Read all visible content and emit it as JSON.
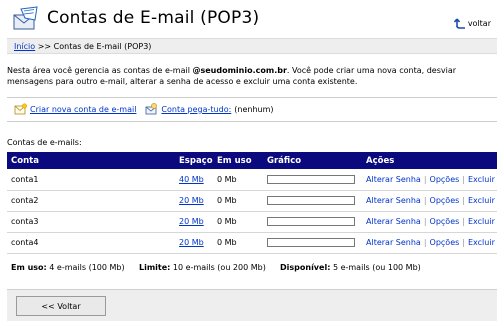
{
  "header": {
    "title": "Contas de E-mail (POP3)",
    "back_label": "voltar"
  },
  "breadcrumb": {
    "home": "Início",
    "separator": ">>",
    "current": "Contas de E-mail (POP3)"
  },
  "intro": {
    "text_before": "Nesta área você gerencia as contas de e-mail ",
    "domain": "@seudominio.com.br",
    "text_after": ". Você pode criar uma nova conta, desviar mensagens para outro e-mail, alterar a senha de acesso e excluir uma conta existente."
  },
  "actions": {
    "create_label": "Criar nova conta de e-mail",
    "catchall_label": "Conta pega-tudo:",
    "catchall_value": "(nenhum)"
  },
  "accounts_label": "Contas de e-mails:",
  "table": {
    "headers": [
      "Conta",
      "Espaço",
      "Em uso",
      "Gráfico",
      "Ações"
    ],
    "rows": [
      {
        "account": "conta1",
        "space": "40 Mb",
        "usage": "0 Mb",
        "graph_fraction": 0
      },
      {
        "account": "conta2",
        "space": "20 Mb",
        "usage": "0 Mb",
        "graph_fraction": 0
      },
      {
        "account": "conta3",
        "space": "20 Mb",
        "usage": "0 Mb",
        "graph_fraction": 0
      },
      {
        "account": "conta4",
        "space": "20 Mb",
        "usage": "0 Mb",
        "graph_fraction": 0
      }
    ],
    "row_actions": {
      "change_password": "Alterar Senha",
      "options": "Opções",
      "delete": "Excluir",
      "separator": "|"
    }
  },
  "summary": {
    "in_use_label": "Em uso:",
    "in_use_value": "4 e-mails (100 Mb)",
    "limit_label": "Limite:",
    "limit_value": "10 e-mails (ou 200 Mb)",
    "available_label": "Disponível:",
    "available_value": "5 e-mails (ou 100 Mb)"
  },
  "bottom": {
    "back_button": "<< Voltar"
  },
  "colors": {
    "table_header_bg": "#0a0a7e",
    "link": "#0033cc"
  }
}
